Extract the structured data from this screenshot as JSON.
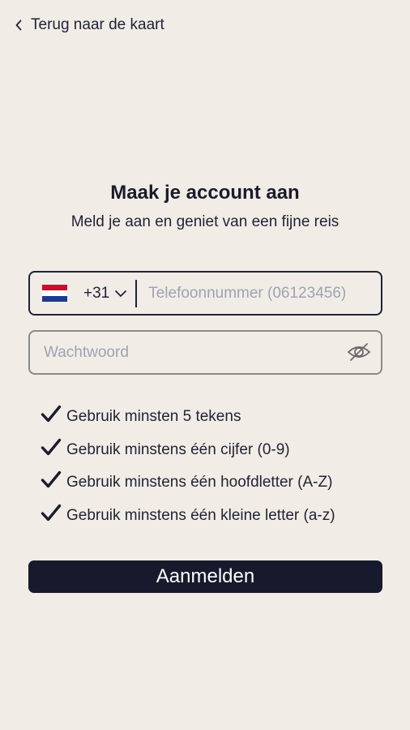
{
  "header": {
    "back_label": "Terug naar de kaart",
    "back_icon": "chevron-left-icon"
  },
  "main": {
    "title": "Maak je account aan",
    "subtitle": "Meld je aan en geniet van een fijne reis"
  },
  "phone": {
    "flag_icon": "netherlands-flag-icon",
    "country_code": "+31",
    "placeholder": "Telefoonnummer (06123456)",
    "value": ""
  },
  "password": {
    "placeholder": "Wachtwoord",
    "value": "",
    "toggle_icon": "eye-off-icon"
  },
  "rules": [
    {
      "label": "Gebruik minsten 5 tekens",
      "icon": "checkmark-icon"
    },
    {
      "label": "Gebruik minstens één cijfer (0-9)",
      "icon": "checkmark-icon"
    },
    {
      "label": "Gebruik minstens één hoofdletter (A-Z)",
      "icon": "checkmark-icon"
    },
    {
      "label": "Gebruik minstens één kleine letter (a-z)",
      "icon": "checkmark-icon"
    }
  ],
  "submit": {
    "label": "Aanmelden"
  },
  "colors": {
    "background": "#f1ede6",
    "primary": "#161a2c",
    "placeholder": "#9ea2b4",
    "inactive_border": "#8a8a8a"
  }
}
